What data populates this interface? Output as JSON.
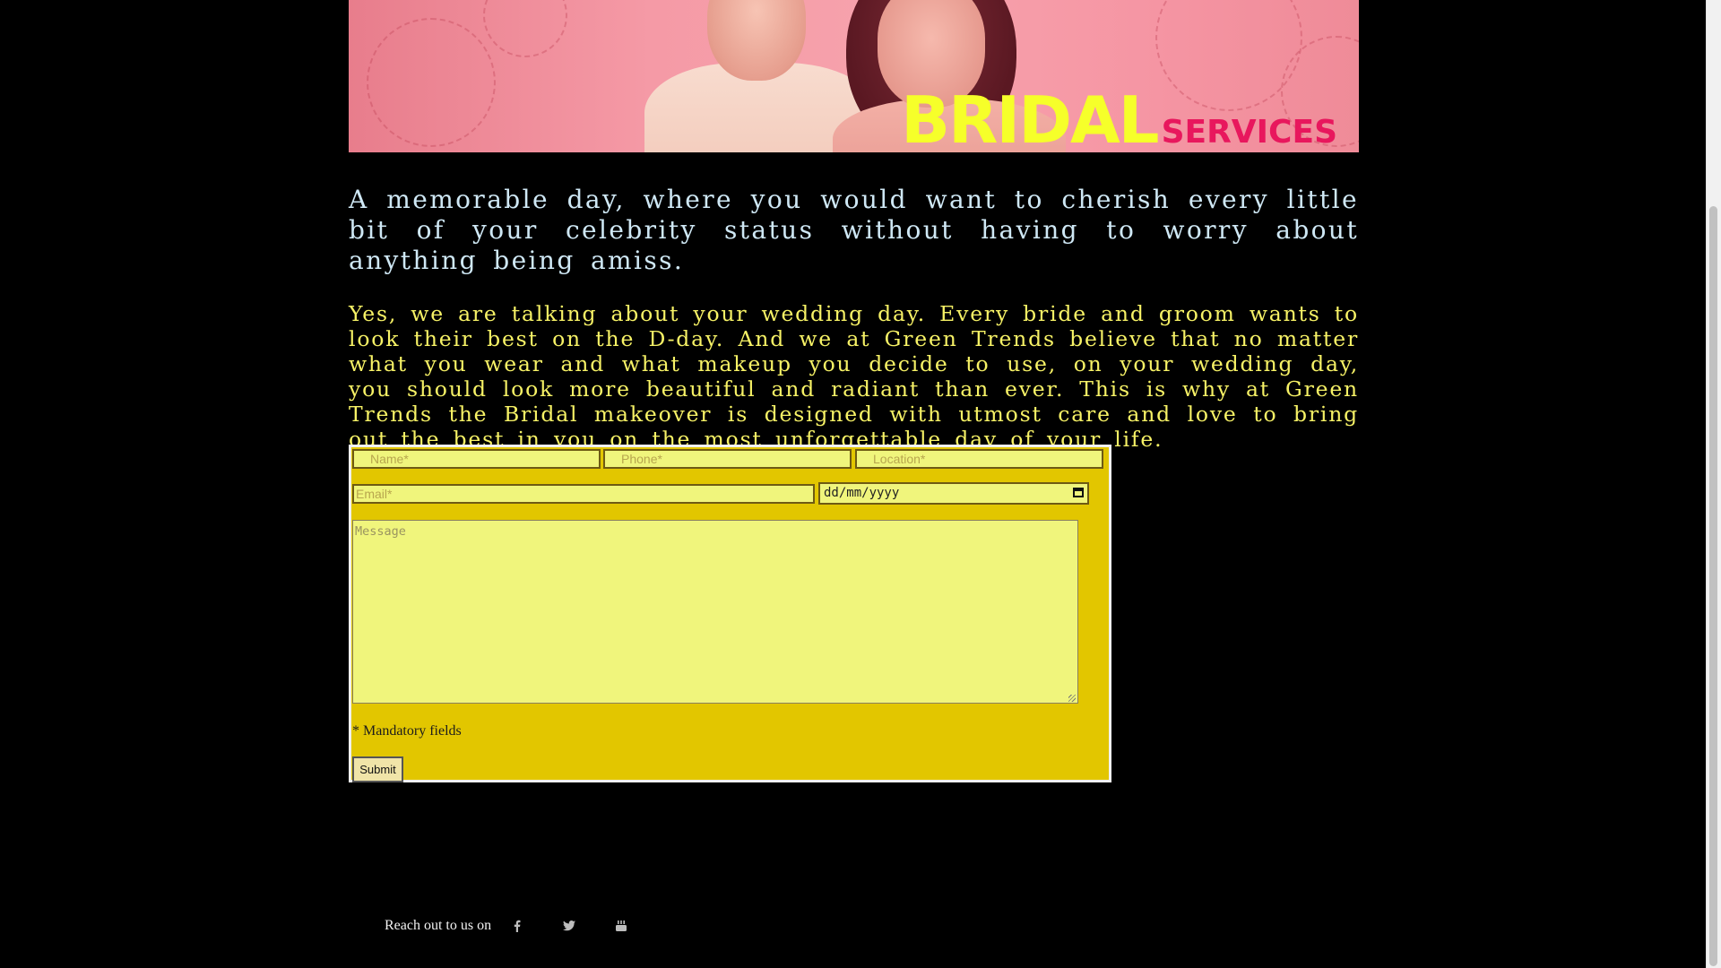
{
  "banner": {
    "title_main": "BRIDAL",
    "title_sub": "SERVICES"
  },
  "content": {
    "intro": "A memorable day, where you would want to cherish every little bit of your celebrity status without having to worry about anything being amiss.",
    "body": "Yes, we are talking about your wedding day. Every bride and groom wants to look their best on the D-day. And we at Green Trends believe that no matter what you wear and what makeup you decide to use, on your wedding day, you should look more beautiful and radiant than ever. This is why at Green Trends the Bridal makeover is designed with utmost care and love to bring out the best in you on the most unforgettable day of your life."
  },
  "form": {
    "name_placeholder": "Name*",
    "phone_placeholder": "Phone*",
    "location_placeholder": "Location*",
    "email_placeholder": "Email*",
    "date_value": "dd/mm/yyyy",
    "message_placeholder": "Message",
    "mandatory_note": "* Mandatory fields",
    "submit_label": "Submit"
  },
  "footer": {
    "reach_text": "Reach out to us on",
    "social": [
      {
        "icon": "facebook-icon"
      },
      {
        "icon": "twitter-icon"
      },
      {
        "icon": "youtube-icon"
      }
    ]
  },
  "colors": {
    "background": "#000000",
    "intro_text": "#cfe8f5",
    "body_text": "#f7f266",
    "form_bg": "#e2c600",
    "field_bg": "#f0f57c",
    "banner_title": "#f6ff2a",
    "banner_subtitle": "#e8175d"
  }
}
